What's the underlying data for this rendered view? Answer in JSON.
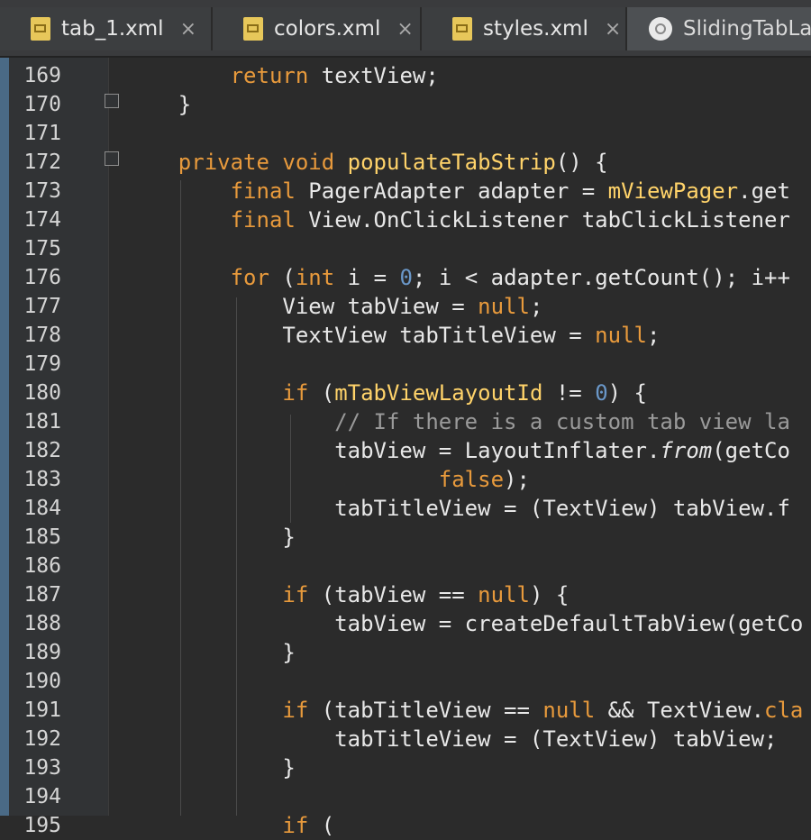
{
  "tabs": [
    {
      "label": "tab_1.xml",
      "close": "×"
    },
    {
      "label": "colors.xml",
      "close": "×"
    },
    {
      "label": "styles.xml",
      "close": "×"
    },
    {
      "label": "SlidingTabLa",
      "close": ""
    }
  ],
  "editor": {
    "lines": [
      {
        "no": "169",
        "html": "        <span class='kw'>return</span> textView;"
      },
      {
        "no": "170",
        "html": "    }"
      },
      {
        "no": "171",
        "html": ""
      },
      {
        "no": "172",
        "html": "    <span class='kw'>private void</span> <span class='meth'>populateTabStrip</span>() {"
      },
      {
        "no": "173",
        "html": "        <span class='kw'>final</span> PagerAdapter adapter = <span class='fld'>mViewPager</span>.get"
      },
      {
        "no": "174",
        "html": "        <span class='kw'>final</span> View.OnClickListener tabClickListener"
      },
      {
        "no": "175",
        "html": ""
      },
      {
        "no": "176",
        "html": "        <span class='kw'>for</span> (<span class='kw'>int</span> i = <span class='num'>0</span>; i &lt; adapter.getCount(); i++"
      },
      {
        "no": "177",
        "html": "            View tabView = <span class='kw'>null</span>;"
      },
      {
        "no": "178",
        "html": "            TextView tabTitleView = <span class='kw'>null</span>;"
      },
      {
        "no": "179",
        "html": ""
      },
      {
        "no": "180",
        "html": "            <span class='kw'>if</span> (<span class='fld'>mTabViewLayoutId</span> != <span class='num'>0</span>) {"
      },
      {
        "no": "181",
        "html": "                <span class='com'>// If there is a custom tab view la</span>"
      },
      {
        "no": "182",
        "html": "                tabView = LayoutInflater.<span class='ital'>from</span>(getCo"
      },
      {
        "no": "183",
        "html": "                        <span class='kw'>false</span>);"
      },
      {
        "no": "184",
        "html": "                tabTitleView = (TextView) tabView.f"
      },
      {
        "no": "185",
        "html": "            }"
      },
      {
        "no": "186",
        "html": ""
      },
      {
        "no": "187",
        "html": "            <span class='kw'>if</span> (tabView == <span class='kw'>null</span>) {"
      },
      {
        "no": "188",
        "html": "                tabView = createDefaultTabView(getCo"
      },
      {
        "no": "189",
        "html": "            }"
      },
      {
        "no": "190",
        "html": ""
      },
      {
        "no": "191",
        "html": "            <span class='kw'>if</span> (tabTitleView == <span class='kw'>null</span> &amp;&amp; TextView.<span class='kw'>cla</span>"
      },
      {
        "no": "192",
        "html": "                tabTitleView = (TextView) tabView;"
      },
      {
        "no": "193",
        "html": "            }"
      },
      {
        "no": "194",
        "html": ""
      },
      {
        "no": "195",
        "html": "            <span class='kw'>if</span> (   "
      }
    ]
  },
  "icons": {
    "file": "xml-file-icon",
    "class": "java-class-icon",
    "fold": "fold-marker-icon",
    "pointer": "mouse-pointer-icon"
  }
}
